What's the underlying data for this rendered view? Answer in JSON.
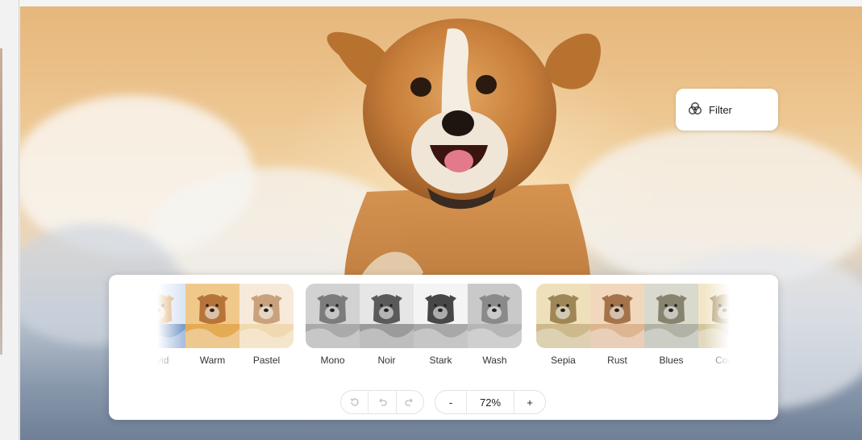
{
  "overlay": {
    "filter_label": "Filter"
  },
  "filters": {
    "groups": [
      {
        "items": [
          {
            "label": "Vivid",
            "tone": "vivid"
          },
          {
            "label": "Warm",
            "tone": "warm"
          },
          {
            "label": "Pastel",
            "tone": "pastel"
          }
        ]
      },
      {
        "items": [
          {
            "label": "Mono",
            "tone": "mono"
          },
          {
            "label": "Noir",
            "tone": "noir"
          },
          {
            "label": "Stark",
            "tone": "stark"
          },
          {
            "label": "Wash",
            "tone": "wash"
          }
        ]
      },
      {
        "items": [
          {
            "label": "Sepia",
            "tone": "sepia"
          },
          {
            "label": "Rust",
            "tone": "rust"
          },
          {
            "label": "Blues",
            "tone": "blues"
          },
          {
            "label": "Cool",
            "tone": "cool"
          }
        ]
      }
    ]
  },
  "toolbar": {
    "zoom_out_label": "-",
    "zoom_value": "72%",
    "zoom_in_label": "+"
  },
  "icons": {
    "filter": "filter-circles-icon",
    "revert": "revert-icon",
    "undo": "undo-icon",
    "redo": "redo-icon"
  },
  "colors": {
    "panel_bg": "#ffffff",
    "text": "#222222",
    "muted": "#b9b9bd"
  }
}
